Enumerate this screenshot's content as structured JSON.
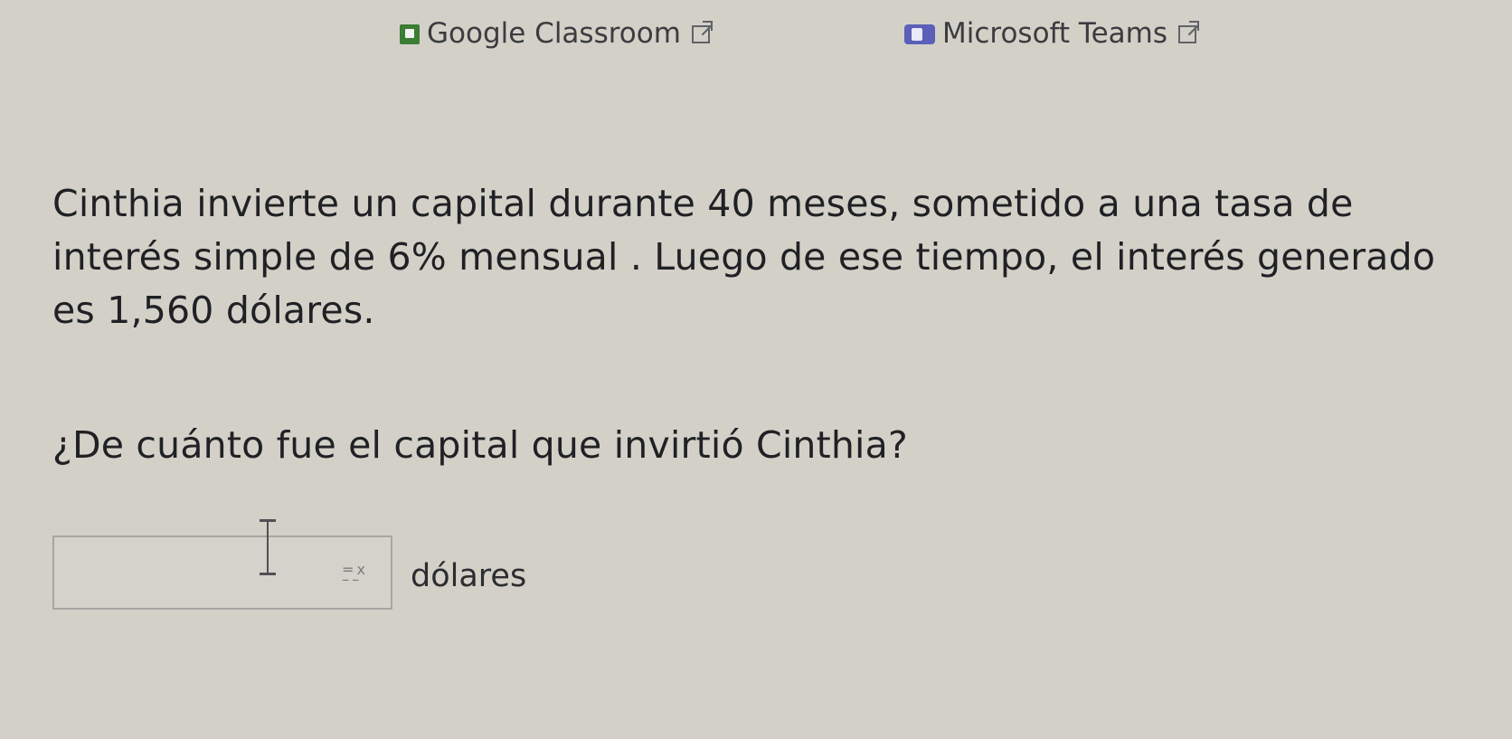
{
  "links": {
    "classroom": {
      "label": "Google Classroom",
      "icon": "google-classroom-icon"
    },
    "teams": {
      "label": "Microsoft Teams",
      "icon": "microsoft-teams-icon"
    }
  },
  "problem": {
    "statement": "Cinthia invierte un capital durante 40 meses, sometido a una tasa de interés simple de 6% mensual . Luego de ese tiempo, el interés generado es 1,560 dólares.",
    "question": "¿De cuánto fue el capital que invirtió Cinthia?"
  },
  "answer": {
    "value": "",
    "placeholder": "",
    "unit": "dólares"
  },
  "icons": {
    "open": "external-link-icon",
    "cursor": "text-cursor-icon",
    "math": "math-symbol-icon"
  }
}
